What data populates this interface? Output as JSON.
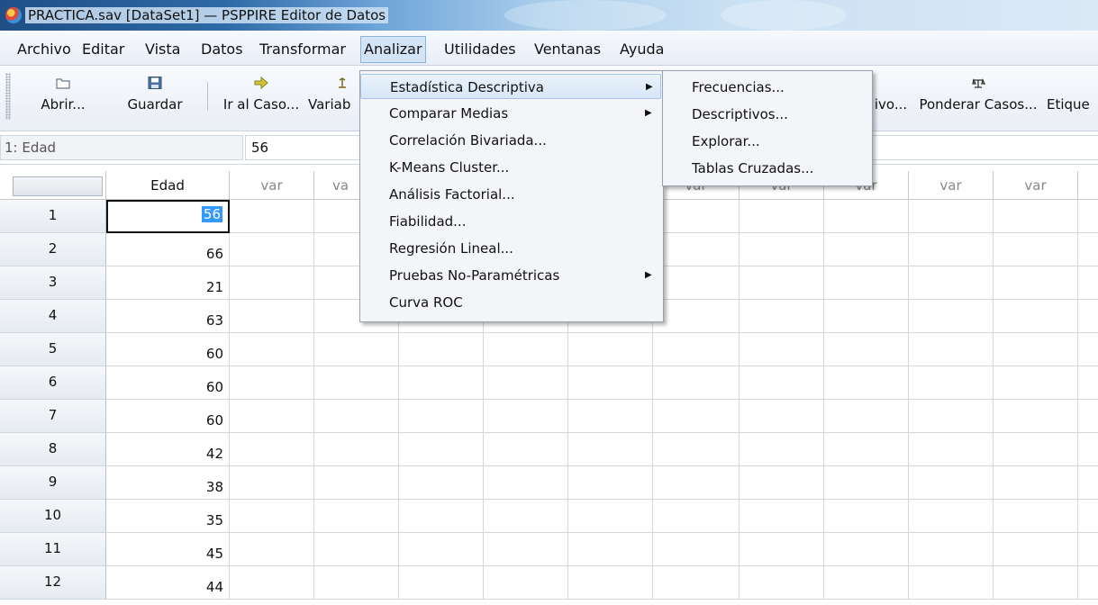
{
  "window": {
    "title": "PRACTICA.sav [DataSet1] — PSPPIRE Editor de Datos"
  },
  "menubar": {
    "items": [
      {
        "label": "Archivo"
      },
      {
        "label": "Editar"
      },
      {
        "label": "Vista"
      },
      {
        "label": "Datos"
      },
      {
        "label": "Transformar"
      },
      {
        "label": "Analizar"
      },
      {
        "label": "Utilidades"
      },
      {
        "label": "Ventanas"
      },
      {
        "label": "Ayuda"
      }
    ],
    "active": "Analizar"
  },
  "toolbar": {
    "items": [
      {
        "label": "Abrir...",
        "icon": "open-folder-icon"
      },
      {
        "label": "Guardar",
        "icon": "save-disk-icon"
      },
      {
        "label": "Ir al Caso...",
        "icon": "goto-case-icon"
      },
      {
        "label": "Variab",
        "icon": "variable-icon"
      },
      {
        "label": "ivo...",
        "icon": ""
      },
      {
        "label": "Ponderar Casos...",
        "icon": "weight-cases-icon"
      },
      {
        "label": "Etique",
        "icon": ""
      }
    ]
  },
  "refbar": {
    "cell_name": "1: Edad",
    "cell_value": "56"
  },
  "grid": {
    "columns": [
      "Edad",
      "var",
      "va",
      "var",
      "var",
      "var",
      "var",
      "var",
      "var",
      "var",
      "var"
    ],
    "rows": [
      {
        "n": "1",
        "edad": "56"
      },
      {
        "n": "2",
        "edad": "66"
      },
      {
        "n": "3",
        "edad": "21"
      },
      {
        "n": "4",
        "edad": "63"
      },
      {
        "n": "5",
        "edad": "60"
      },
      {
        "n": "6",
        "edad": "60"
      },
      {
        "n": "7",
        "edad": "60"
      },
      {
        "n": "8",
        "edad": "42"
      },
      {
        "n": "9",
        "edad": "38"
      },
      {
        "n": "10",
        "edad": "35"
      },
      {
        "n": "11",
        "edad": "45"
      },
      {
        "n": "12",
        "edad": "44"
      }
    ]
  },
  "analizar_menu": {
    "items": [
      {
        "label": "Estadística Descriptiva",
        "submenu": true
      },
      {
        "label": "Comparar Medias",
        "submenu": true
      },
      {
        "label": "Correlación Bivariada..."
      },
      {
        "label": "K-Means Cluster..."
      },
      {
        "label": "Análisis Factorial..."
      },
      {
        "label": "Fiabilidad..."
      },
      {
        "label": "Regresión Lineal..."
      },
      {
        "label": "Pruebas No-Paramétricas",
        "submenu": true
      },
      {
        "label": "Curva ROC"
      }
    ],
    "highlighted": "Estadística Descriptiva"
  },
  "descriptiva_submenu": {
    "items": [
      {
        "label": "Frecuencias..."
      },
      {
        "label": "Descriptivos..."
      },
      {
        "label": "Explorar..."
      },
      {
        "label": "Tablas Cruzadas..."
      }
    ]
  },
  "colors": {
    "selection": "#3399ff",
    "menu_highlight": "#d7e6f7",
    "titlebar": "#2e6aa6"
  }
}
